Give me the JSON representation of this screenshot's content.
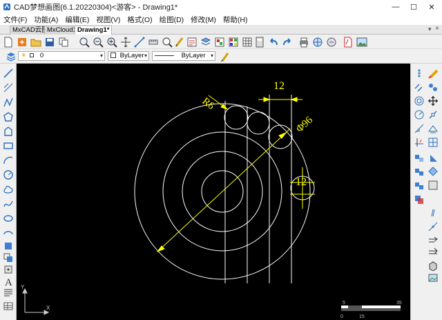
{
  "window": {
    "title": "CAD梦想画图(6.1.20220304)<游客> - Drawing1*",
    "minimize": "—",
    "maximize": "☐",
    "close": "✕"
  },
  "menu": [
    "文件(F)",
    "功能(A)",
    "编辑(E)",
    "视图(V)",
    "格式(O)",
    "绘图(D)",
    "修改(M)",
    "帮助(H)"
  ],
  "tabs": [
    {
      "label": "MxCAD云图",
      "active": false
    },
    {
      "label": "MxCloud1",
      "active": false
    },
    {
      "label": "Drawing1*",
      "active": true
    }
  ],
  "properties": {
    "layer_value": "0",
    "color_value": "ByLayer",
    "linetype_value": "ByLayer"
  },
  "drawing": {
    "labels": {
      "radius": "R6",
      "width_top": "12",
      "diameter": "Φ96",
      "width_right": "12"
    }
  },
  "scale_bar": {
    "ticks": [
      "0",
      "5",
      "15",
      "35"
    ]
  },
  "axis": {
    "x": "X",
    "y": "Y"
  },
  "colors": {
    "canvas_bg": "#000000",
    "geometry": "#ffffff",
    "dimensions": "#ffff00",
    "ui_bg": "#f0f0f0"
  }
}
